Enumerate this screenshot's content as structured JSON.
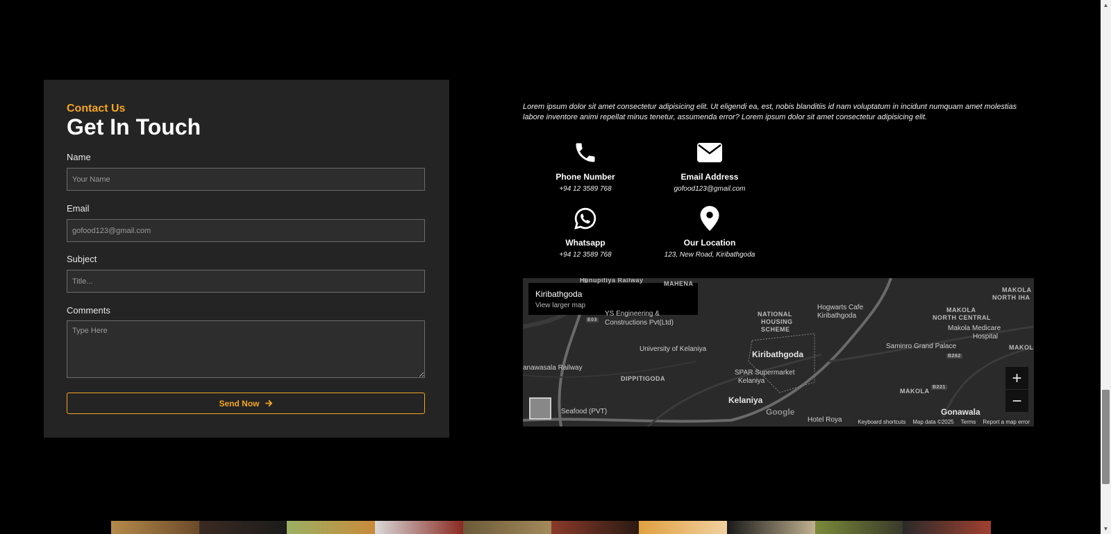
{
  "contact": {
    "eyebrow": "Contact Us",
    "title": "Get In Touch",
    "name_label": "Name",
    "name_placeholder": "Your Name",
    "email_label": "Email",
    "email_placeholder": "gofood123@gmail.com",
    "subject_label": "Subject",
    "subject_placeholder": "Title...",
    "comments_label": "Comments",
    "comments_placeholder": "Type Here",
    "send_label": "Send Now"
  },
  "intro": "Lorem ipsum dolor sit amet consectetur adipisicing elit. Ut eligendi ea, est, nobis blanditiis id nam voluptatum in incidunt numquam amet molestias labore inventore animi repellat minus tenetur, assumenda error? Lorem ipsum dolor sit amet consectetur adipisicing elit.",
  "info": {
    "phone": {
      "title": "Phone Number",
      "value": "+94 12 3589 768",
      "icon": "phone-icon"
    },
    "email": {
      "title": "Email Address",
      "value": "gofood123@gmail.com",
      "icon": "envelope-icon"
    },
    "whatsapp": {
      "title": "Whatsapp",
      "value": "+94 12 3589 768",
      "icon": "whatsapp-icon"
    },
    "location": {
      "title": "Our Location",
      "value": "123, New Road, Kiribathgoda",
      "icon": "location-pin-icon"
    }
  },
  "map": {
    "place": "Kiribathgoda",
    "view_larger": "View larger map",
    "labels": {
      "hunupitiya": "Hunupitiya Railway",
      "mahena": "MAHENA",
      "engineering": "YS Engineering &",
      "engineering2": "Constructions Pvt(Ltd)",
      "national_housing": "NATIONAL",
      "national_housing2": "HOUSING",
      "national_housing3": "SCHEME",
      "hogwarts": "Hogwarts Cafe",
      "hogwarts2": "Kiribathgoda",
      "makola_north": "MAKOLA",
      "makola_north2": "NORTH IHA",
      "makola_central": "MAKOLA",
      "makola_central2": "NORTH CENTRAL",
      "makola_hospital": "Makola Medicare",
      "makola_hospital2": "Hospital",
      "university": "University of Kelaniya",
      "kiribathgoda": "Kiribathgoda",
      "saminro": "Saminro Grand Palace",
      "makola_right": "MAKOL",
      "railway": "anawasala Railway",
      "dippitigoda": "DIPPITIGODA",
      "spar": "SPAR Supermarket",
      "spar2": "Kelaniya",
      "kelaniya": "Kelaniya",
      "makola": "MAKOLA",
      "seafood": "Seafood (PVT)",
      "gonawala": "Gonawala",
      "hotel": "Hotel Roya",
      "road_e03": "E03",
      "road_b262": "B262",
      "road_b221": "B221"
    },
    "zoom_in": "+",
    "zoom_out": "−",
    "google": "Google",
    "footer": {
      "shortcuts": "Keyboard shortcuts",
      "data": "Map data ©2025",
      "terms": "Terms",
      "report": "Report a map error"
    }
  },
  "colors": {
    "accent": "#f5a623",
    "card_bg": "#242424",
    "page_bg": "#000000"
  }
}
